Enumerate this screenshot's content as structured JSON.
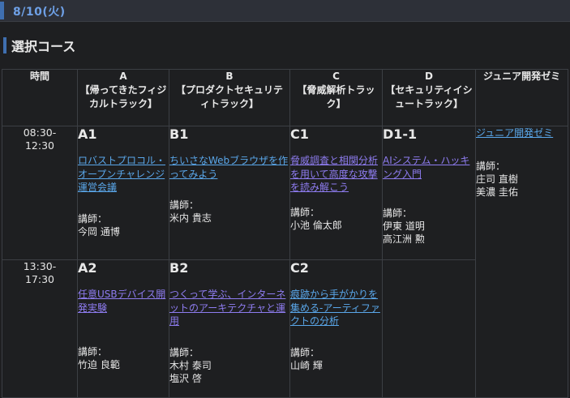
{
  "date": "8/10(火)",
  "section_title": "選択コース",
  "headers": {
    "time": "時間",
    "tracks": [
      {
        "letter": "A",
        "name": "【帰ってきたフィジカルトラック】"
      },
      {
        "letter": "B",
        "name": "【プロダクトセキュリティトラック】"
      },
      {
        "letter": "C",
        "name": "【脅威解析トラック】"
      },
      {
        "letter": "D",
        "name": "【セキュリティイシュートラック】"
      }
    ],
    "junior": "ジュニア開発ゼミ"
  },
  "lecturer_label": "講師：",
  "rows": [
    {
      "time": [
        "08:30-",
        "12:30"
      ],
      "cells": [
        {
          "code": "A1",
          "title": "ロバストプロコル・オープンチャレンジ運営会議",
          "lecturers": [
            "今岡 通博"
          ],
          "link_color": "blue"
        },
        {
          "code": "B1",
          "title": "ちいさなWebブラウザを作ってみよう",
          "lecturers": [
            "米内 貴志"
          ],
          "link_color": "blue"
        },
        {
          "code": "C1",
          "title": "脅威調査と相関分析を用いて高度な攻撃を読み解こう",
          "lecturers": [
            "小池 倫太郎"
          ],
          "link_color": "purple"
        },
        {
          "code": "D1-1",
          "title": "AIシステム・ハッキング入門",
          "lecturers": [
            "伊東 道明",
            "高江洲 勲"
          ],
          "link_color": "purple"
        }
      ]
    },
    {
      "time": [
        "13:30-",
        "17:30"
      ],
      "cells": [
        {
          "code": "A2",
          "title": "任意USBデバイス開発実験",
          "lecturers": [
            "竹迫 良範"
          ],
          "link_color": "purple"
        },
        {
          "code": "B2",
          "title": "つくって学ぶ、インターネットのアーキテクチャと運用",
          "lecturers": [
            "木村 泰司",
            "塩沢 啓"
          ],
          "link_color": "purple"
        },
        {
          "code": "C2",
          "title": "痕跡から手がかりを集める-アーティファクトの分析",
          "lecturers": [
            "山崎 輝"
          ],
          "link_color": "blue"
        }
      ]
    }
  ],
  "junior_cell": {
    "title": "ジュニア開発ゼミ",
    "lecturers": [
      "庄司 直樹",
      "美濃 圭佑"
    ],
    "link_color": "blue"
  }
}
